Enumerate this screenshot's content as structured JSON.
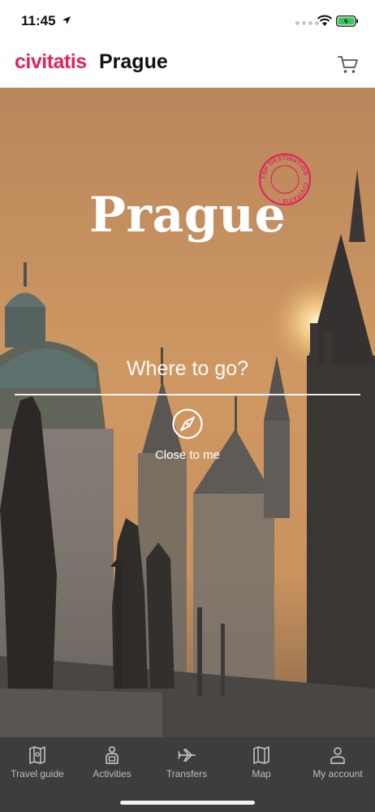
{
  "status": {
    "time": "11:45"
  },
  "header": {
    "brand": "civitatis",
    "city": "Prague"
  },
  "hero": {
    "title": "Prague",
    "stamp_text": "TOP DESTINATION · CIVITATIS ·",
    "search_placeholder": "Where to go?",
    "close_to_me": "Close to me"
  },
  "tabs": [
    {
      "label": "Travel guide",
      "icon": "map-book-icon"
    },
    {
      "label": "Activities",
      "icon": "person-ticket-icon"
    },
    {
      "label": "Transfers",
      "icon": "plane-icon"
    },
    {
      "label": "Map",
      "icon": "map-icon"
    },
    {
      "label": "My account",
      "icon": "user-icon"
    }
  ],
  "colors": {
    "brand": "#e0245e",
    "tabbar": "#3d3d3d",
    "sky_top": "#b9875c",
    "sky_bottom": "#d9a066"
  }
}
